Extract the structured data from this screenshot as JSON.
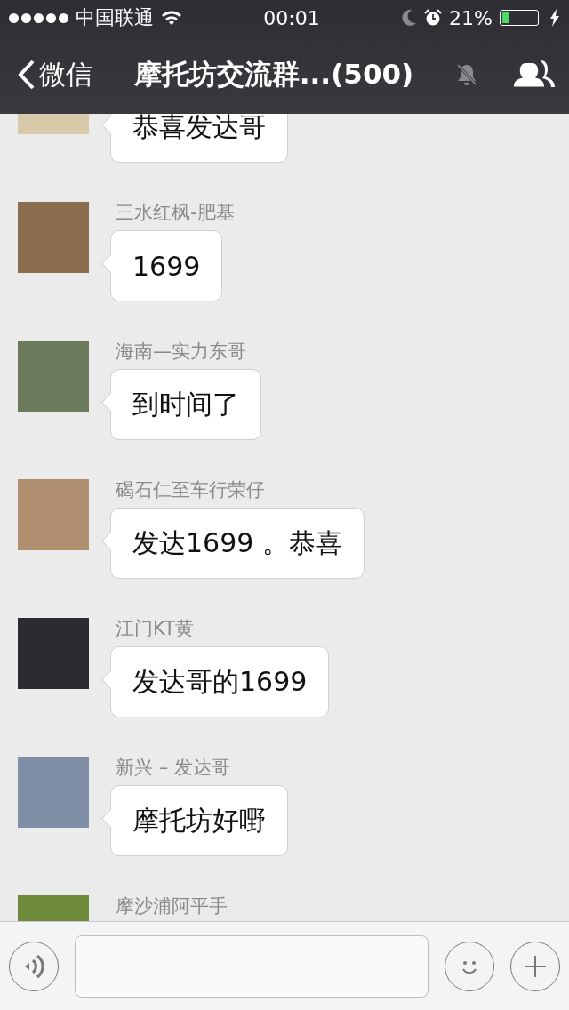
{
  "status_bar": {
    "carrier": "中国联通",
    "time": "00:01",
    "battery_percent": "21%",
    "battery": {
      "level": 0.21
    }
  },
  "nav": {
    "back_label": "微信",
    "title": "摩托坊交流群...(500)"
  },
  "messages": [
    {
      "text": "恭喜发达哥"
    },
    {
      "sender": "三水红枫-肥基",
      "text": "1699"
    },
    {
      "sender": "海南—实力东哥",
      "text": "到时间了"
    },
    {
      "sender": "碣石仁至车行荣仔",
      "text": "发达1699 。恭喜"
    },
    {
      "sender": "江门KT黄",
      "text": "发达哥的1699"
    },
    {
      "sender": "新兴 – 发达哥",
      "text": "摩托坊好嘢"
    },
    {
      "sender": "摩沙浦阿平手"
    }
  ]
}
